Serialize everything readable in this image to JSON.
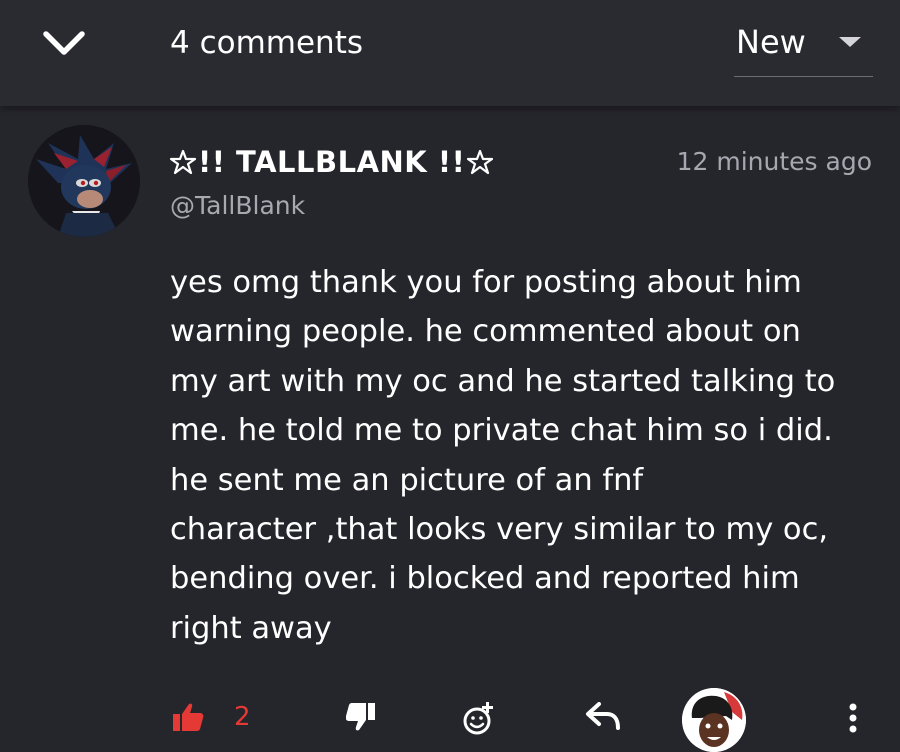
{
  "header": {
    "title": "4 comments",
    "sort": {
      "selected": "New"
    }
  },
  "comment": {
    "author": {
      "display_name": "!! TALLBLANK !!",
      "handle": "@TallBlank"
    },
    "timestamp": "12 minutes ago",
    "body_lines": [
      "yes omg thank you for posting about him",
      "warning people. he commented about on",
      "my art with my oc and he started talking to",
      "me. he told me to private chat him so i did.",
      "he sent me an picture of an fnf",
      "character ,that looks very similar to my oc,",
      "bending over. i blocked and reported him",
      "right away"
    ],
    "like_count": "2"
  },
  "colors": {
    "background": "#25252c",
    "header_background": "#2a2a31",
    "accent_like": "#e53935",
    "secondary_text": "#a7a7b0"
  },
  "icons": {
    "back": "chevron-down-icon",
    "sort": "caret-down-icon",
    "like": "thumbs-up-icon",
    "dislike": "thumbs-down-icon",
    "react": "add-emoji-icon",
    "reply": "reply-arrow-icon",
    "more": "more-vertical-icon",
    "decoration": "pentagram-star-icon"
  }
}
